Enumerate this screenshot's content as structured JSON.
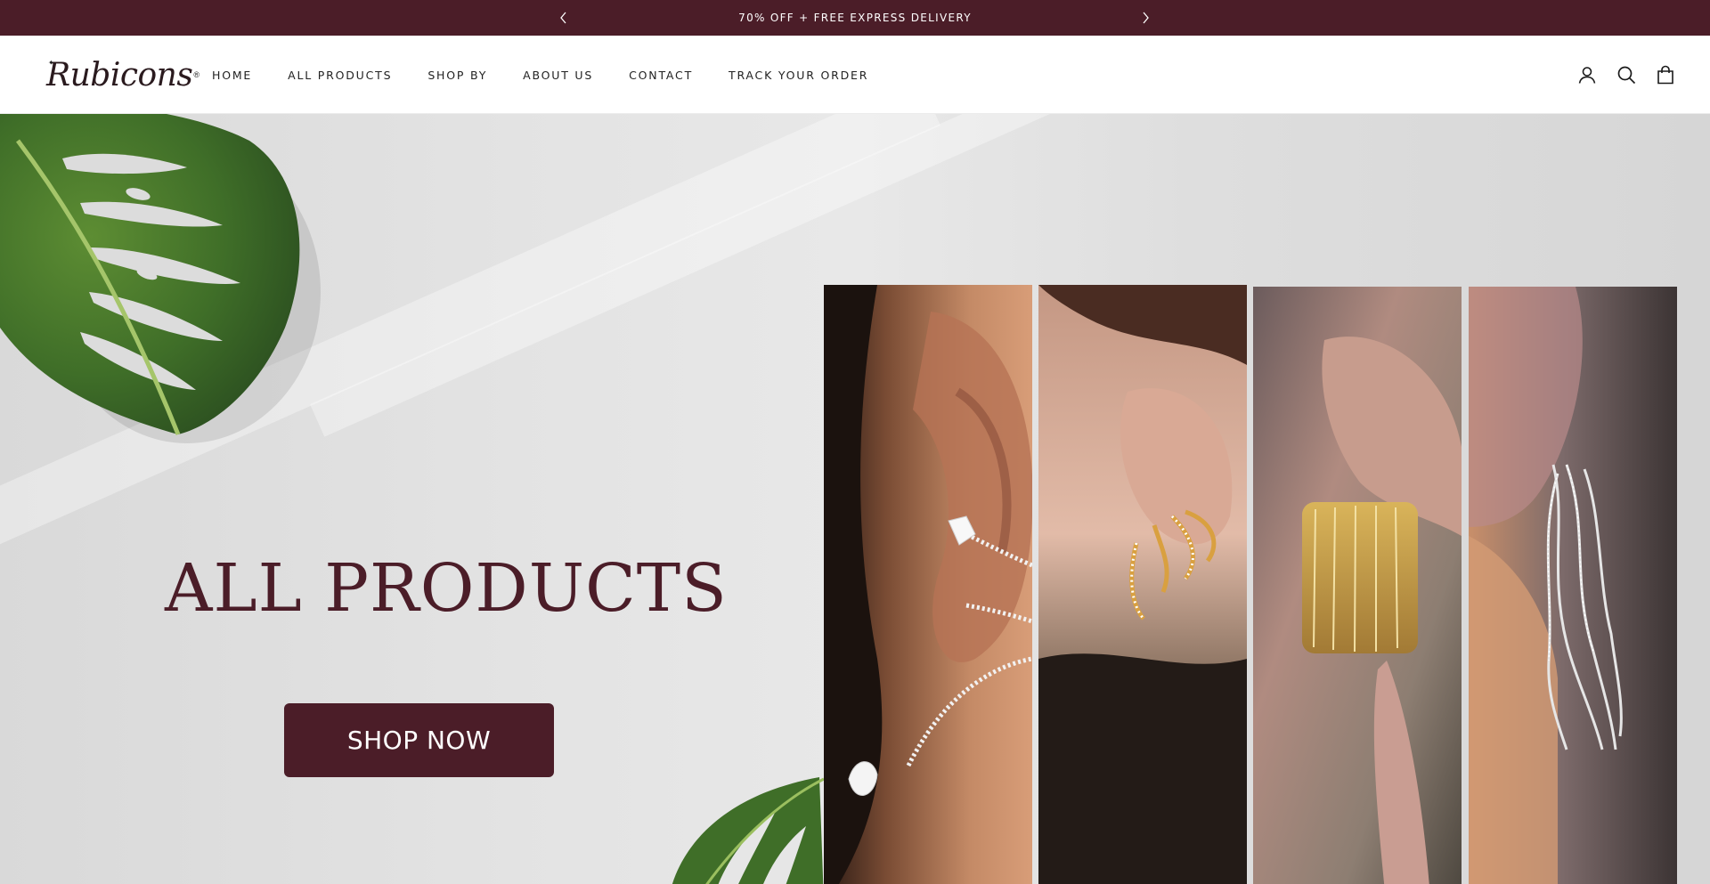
{
  "announcement": {
    "message": "70% OFF + FREE EXPRESS DELIVERY",
    "prev_icon": "chevron-left-icon",
    "next_icon": "chevron-right-icon"
  },
  "header": {
    "logo_text": "Rubicons",
    "nav": [
      {
        "label": "HOME"
      },
      {
        "label": "ALL PRODUCTS"
      },
      {
        "label": "SHOP BY"
      },
      {
        "label": "ABOUT US"
      },
      {
        "label": "CONTACT"
      },
      {
        "label": "TRACK YOUR ORDER"
      }
    ],
    "icons": [
      "account-icon",
      "search-icon",
      "cart-icon"
    ]
  },
  "hero": {
    "title": "ALL PRODUCTS",
    "cta_label": "SHOP NOW",
    "panels": [
      "ear-cuff-crystal",
      "gold-claw-earrings",
      "gold-tassel-earrings",
      "silver-tassel-earrings"
    ]
  },
  "colors": {
    "brand": "#4b1d28",
    "background": "#ffffff",
    "hero_bg": "#e3e3e3",
    "leaf": "#3f6e28"
  }
}
